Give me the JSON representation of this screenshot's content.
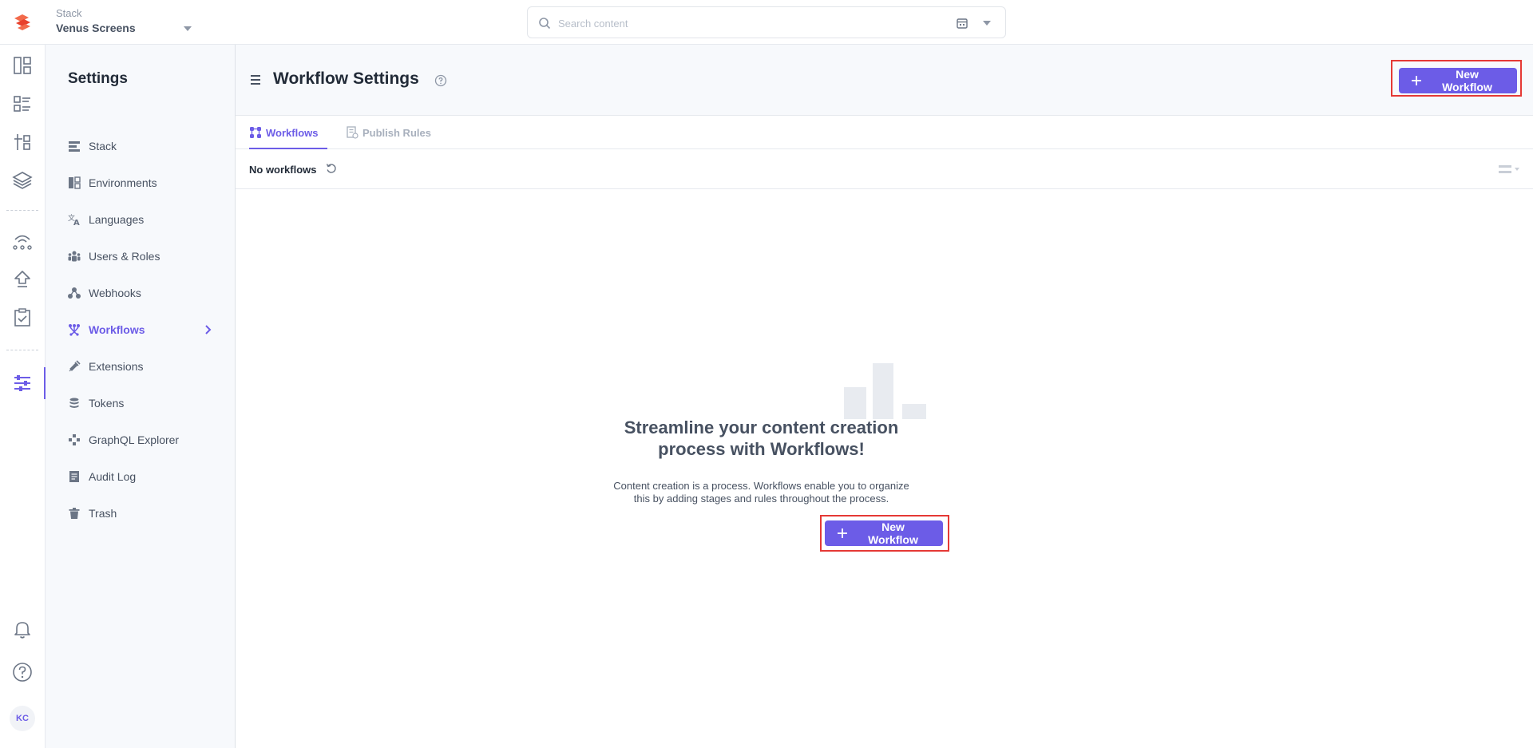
{
  "app": {
    "stack_label": "Stack",
    "stack_name": "Venus Screens",
    "brand_color": "#6c5ce7"
  },
  "search": {
    "placeholder": "Search content"
  },
  "rail": {
    "items": [
      "dashboard-icon",
      "entries-icon",
      "content-models-icon",
      "assets-icon",
      "releases-icon",
      "publish-queue-icon",
      "tasks-icon",
      "settings-icon"
    ],
    "active": "settings-icon",
    "bottom": [
      "notifications-icon",
      "help-icon"
    ],
    "avatar_initials": "KC"
  },
  "settings": {
    "title": "Settings",
    "items": [
      {
        "label": "Stack",
        "icon": "stack-icon"
      },
      {
        "label": "Environments",
        "icon": "environments-icon"
      },
      {
        "label": "Languages",
        "icon": "languages-icon"
      },
      {
        "label": "Users & Roles",
        "icon": "users-icon"
      },
      {
        "label": "Webhooks",
        "icon": "webhooks-icon"
      },
      {
        "label": "Workflows",
        "icon": "workflows-icon",
        "active": true
      },
      {
        "label": "Extensions",
        "icon": "extensions-icon"
      },
      {
        "label": "Tokens",
        "icon": "tokens-icon"
      },
      {
        "label": "GraphQL Explorer",
        "icon": "graphql-icon"
      },
      {
        "label": "Audit Log",
        "icon": "audit-log-icon"
      },
      {
        "label": "Trash",
        "icon": "trash-icon"
      }
    ]
  },
  "header": {
    "title": "Workflow Settings",
    "new_button": "New Workflow"
  },
  "tabs": [
    {
      "label": "Workflows",
      "active": true
    },
    {
      "label": "Publish Rules",
      "active": false
    }
  ],
  "list": {
    "count_text": "No workflows"
  },
  "empty_state": {
    "heading_line1": "Streamline your content creation",
    "heading_line2": "process with Workflows!",
    "text_line1": "Content creation is a process. Workflows enable you to organize",
    "text_line2": "this by adding stages and rules throughout the process.",
    "button": "New Workflow"
  },
  "highlight_color": "#e53935"
}
